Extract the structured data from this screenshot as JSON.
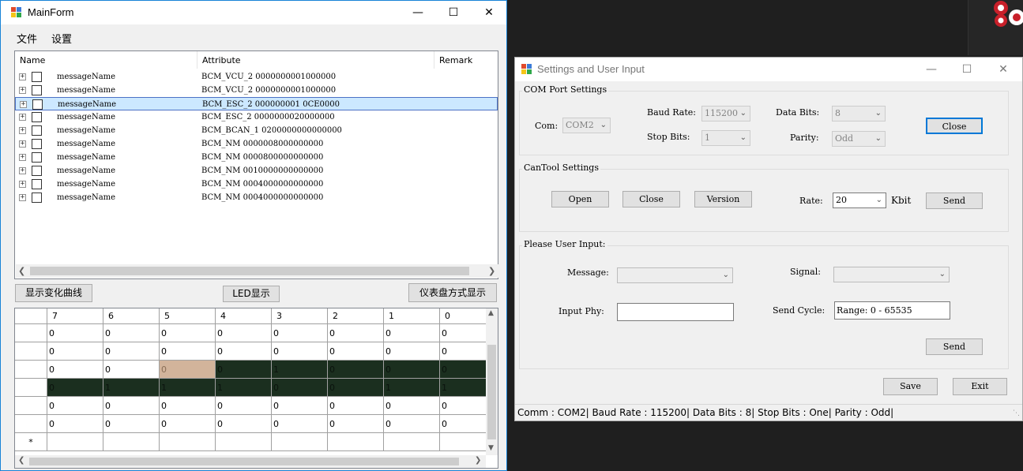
{
  "main_window": {
    "title": "MainForm",
    "menu": [
      "文件",
      "设置"
    ],
    "tree": {
      "columns": [
        "Name",
        "Attribute",
        "Remark"
      ],
      "rows": [
        {
          "name": "messageName",
          "attribute": "BCM_VCU_2  0000000001000000"
        },
        {
          "name": "messageName",
          "attribute": "BCM_VCU_2  0000000001000000"
        },
        {
          "name": "messageName",
          "attribute": "BCM_ESC_2  000000001 0CE0000",
          "selected": true
        },
        {
          "name": "messageName",
          "attribute": "BCM_ESC_2  0000000020000000"
        },
        {
          "name": "messageName",
          "attribute": "BCM_BCAN_1  0200000000000000"
        },
        {
          "name": "messageName",
          "attribute": "BCM_NM  0000008000000000"
        },
        {
          "name": "messageName",
          "attribute": "BCM_NM  0000800000000000"
        },
        {
          "name": "messageName",
          "attribute": "BCM_NM  0010000000000000"
        },
        {
          "name": "messageName",
          "attribute": "BCM_NM  0004000000000000"
        },
        {
          "name": "messageName",
          "attribute": "BCM_NM  0004000000000000"
        }
      ]
    },
    "buttons": {
      "curve": "显示变化曲线",
      "led": "LED显示",
      "dashboard": "仪表盘方式显示"
    },
    "grid": {
      "headers": [
        "7",
        "6",
        "5",
        "4",
        "3",
        "2",
        "1",
        "0"
      ],
      "rows": [
        [
          "0",
          "0",
          "0",
          "0",
          "0",
          "0",
          "0",
          "0"
        ],
        [
          "0",
          "0",
          "0",
          "0",
          "0",
          "0",
          "0",
          "0"
        ],
        [
          "0",
          "0",
          "0",
          "0",
          "1",
          "0",
          "0",
          "0"
        ],
        [
          "0",
          "1",
          "1",
          "1",
          "0",
          "0",
          "1",
          "1"
        ],
        [
          "0",
          "0",
          "0",
          "0",
          "0",
          "0",
          "0",
          "0"
        ],
        [
          "0",
          "0",
          "0",
          "0",
          "0",
          "0",
          "0",
          "0"
        ]
      ],
      "new_row_marker": "*",
      "colors": {
        "dark": "#1b2f1f",
        "highlight": "#d2b49b"
      }
    }
  },
  "settings_window": {
    "title": "Settings and User Input",
    "com_group": {
      "title": "COM Port Settings",
      "com_label": "Com:",
      "com_value": "COM2",
      "baud_label": "Baud Rate:",
      "baud_value": "115200",
      "stop_label": "Stop Bits:",
      "stop_value": "1",
      "data_label": "Data Bits:",
      "data_value": "8",
      "parity_label": "Parity:",
      "parity_value": "Odd",
      "close_button": "Close"
    },
    "cantool_group": {
      "title": "CanTool Settings",
      "open_button": "Open",
      "close_button": "Close",
      "version_button": "Version",
      "rate_label": "Rate:",
      "rate_value": "20",
      "rate_unit": "Kbit",
      "send_button": "Send"
    },
    "input_group": {
      "title": "Please User Input:",
      "message_label": "Message:",
      "signal_label": "Signal:",
      "phy_label": "Input Phy:",
      "cycle_label": "Send Cycle:",
      "cycle_value": "Range: 0 - 65535",
      "send_button": "Send"
    },
    "save_button": "Save",
    "exit_button": "Exit",
    "status": "Comm : COM2|  Baud Rate : 115200|  Data Bits : 8|  Stop Bits : One|  Parity : Odd|"
  }
}
